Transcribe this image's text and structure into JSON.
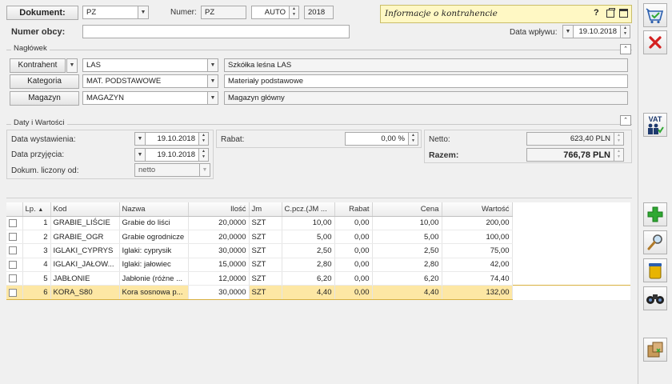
{
  "header": {
    "dokument_label": "Dokument:",
    "dokument_value": "PZ",
    "numer_label": "Numer:",
    "numer_prefix": "PZ",
    "numer_auto": "AUTO",
    "numer_year": "2018",
    "numer_obcy_label": "Numer obcy:",
    "numer_obcy_value": "",
    "info_title": "Informacje o kontrahencie",
    "info_help": "?",
    "data_wplywu_label": "Data wpływu:",
    "data_wplywu_value": "19.10.2018"
  },
  "naglowek": {
    "title": "Nagłówek",
    "kontrahent_label": "Kontrahent",
    "kontrahent_code": "LAS",
    "kontrahent_name": "Szkółka leśna LAS",
    "kategoria_label": "Kategoria",
    "kategoria_code": "MAT. PODSTAWOWE",
    "kategoria_name": "Materiały podstawowe",
    "magazyn_label": "Magazyn",
    "magazyn_code": "MAGAZYN",
    "magazyn_name": "Magazyn główny"
  },
  "daty": {
    "title": "Daty i Wartości",
    "wystawienia_label": "Data wystawienia:",
    "wystawienia_value": "19.10.2018",
    "przyjecia_label": "Data przyjęcia:",
    "przyjecia_value": "19.10.2018",
    "liczony_label": "Dokum. liczony od:",
    "liczony_value": "netto",
    "rabat_label": "Rabat:",
    "rabat_value": "0,00 %",
    "netto_label": "Netto:",
    "netto_value": "623,40 PLN",
    "razem_label": "Razem:",
    "razem_value": "766,78 PLN"
  },
  "table": {
    "columns": [
      "Lp.",
      "Kod",
      "Nazwa",
      "Ilość",
      "Jm",
      "C.pcz.(JM ...",
      "Rabat",
      "Cena",
      "Wartość"
    ],
    "rows": [
      [
        "1",
        "GRABIE_LIŚCIE",
        "Grabie do liści",
        "20,0000",
        "SZT",
        "10,00",
        "0,00",
        "10,00",
        "200,00"
      ],
      [
        "2",
        "GRABIE_OGR",
        "Grabie ogrodnicze",
        "20,0000",
        "SZT",
        "5,00",
        "0,00",
        "5,00",
        "100,00"
      ],
      [
        "3",
        "IGLAKI_CYPRYS",
        "Iglaki: cyprysik",
        "30,0000",
        "SZT",
        "2,50",
        "0,00",
        "2,50",
        "75,00"
      ],
      [
        "4",
        "IGLAKI_JAŁOW...",
        "Iglaki: jałowiec",
        "15,0000",
        "SZT",
        "2,80",
        "0,00",
        "2,80",
        "42,00"
      ],
      [
        "5",
        "JABŁONIE",
        "Jabłonie (różne ...",
        "12,0000",
        "SZT",
        "6,20",
        "0,00",
        "6,20",
        "74,40"
      ],
      [
        "6",
        "KORA_S80",
        "Kora sosnowa p...",
        "30,0000",
        "SZT",
        "4,40",
        "0,00",
        "4,40",
        "132,00"
      ]
    ],
    "selected_row": 6
  },
  "sidebar": {
    "save_icon": "save-basket-icon",
    "cancel_icon": "close-icon",
    "vat_label": "VAT",
    "add_icon": "plus-icon",
    "edit_icon": "magnifier-icon",
    "delete_icon": "trash-icon",
    "find_icon": "binoculars-icon",
    "export_icon": "package-icon"
  },
  "colors": {
    "info_bg": "#fff8c4",
    "selected_row": "#fde7a4",
    "accent_green": "#2fa832",
    "cancel_red": "#d42020"
  }
}
